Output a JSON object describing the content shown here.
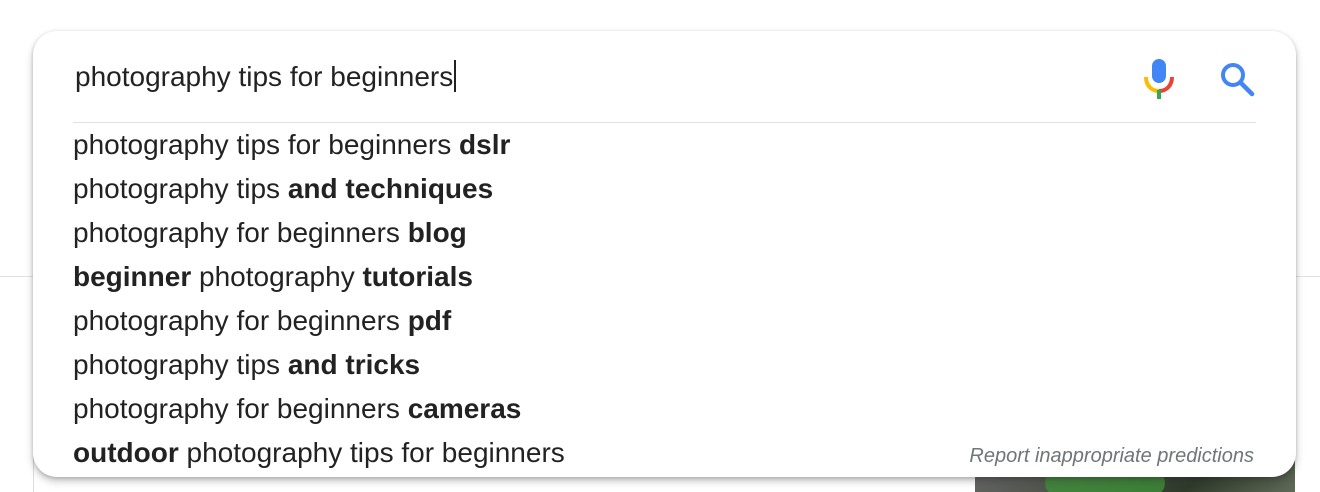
{
  "search": {
    "query": "photography tips for beginners"
  },
  "icons": {
    "mic": "microphone-icon",
    "search": "magnifier-search-icon"
  },
  "colors": {
    "blue": "#4285f4",
    "red": "#ea4335",
    "yellow": "#fbbc05",
    "green": "#34a853",
    "text": "#222222",
    "muted": "#70757a"
  },
  "suggestions": [
    {
      "parts": [
        {
          "text": "photography tips for beginners ",
          "bold": false
        },
        {
          "text": "dslr",
          "bold": true
        }
      ]
    },
    {
      "parts": [
        {
          "text": "photography tips ",
          "bold": false
        },
        {
          "text": "and techniques",
          "bold": true
        }
      ]
    },
    {
      "parts": [
        {
          "text": "photography for beginners ",
          "bold": false
        },
        {
          "text": "blog",
          "bold": true
        }
      ]
    },
    {
      "parts": [
        {
          "text": "beginner",
          "bold": true
        },
        {
          "text": " photography ",
          "bold": false
        },
        {
          "text": "tutorials",
          "bold": true
        }
      ]
    },
    {
      "parts": [
        {
          "text": "photography for beginners ",
          "bold": false
        },
        {
          "text": "pdf",
          "bold": true
        }
      ]
    },
    {
      "parts": [
        {
          "text": "photography tips ",
          "bold": false
        },
        {
          "text": "and tricks",
          "bold": true
        }
      ]
    },
    {
      "parts": [
        {
          "text": "photography for beginners ",
          "bold": false
        },
        {
          "text": "cameras",
          "bold": true
        }
      ]
    },
    {
      "parts": [
        {
          "text": "outdoor",
          "bold": true
        },
        {
          "text": " photography tips for beginners",
          "bold": false
        }
      ]
    }
  ],
  "report_link": "Report inappropriate predictions"
}
